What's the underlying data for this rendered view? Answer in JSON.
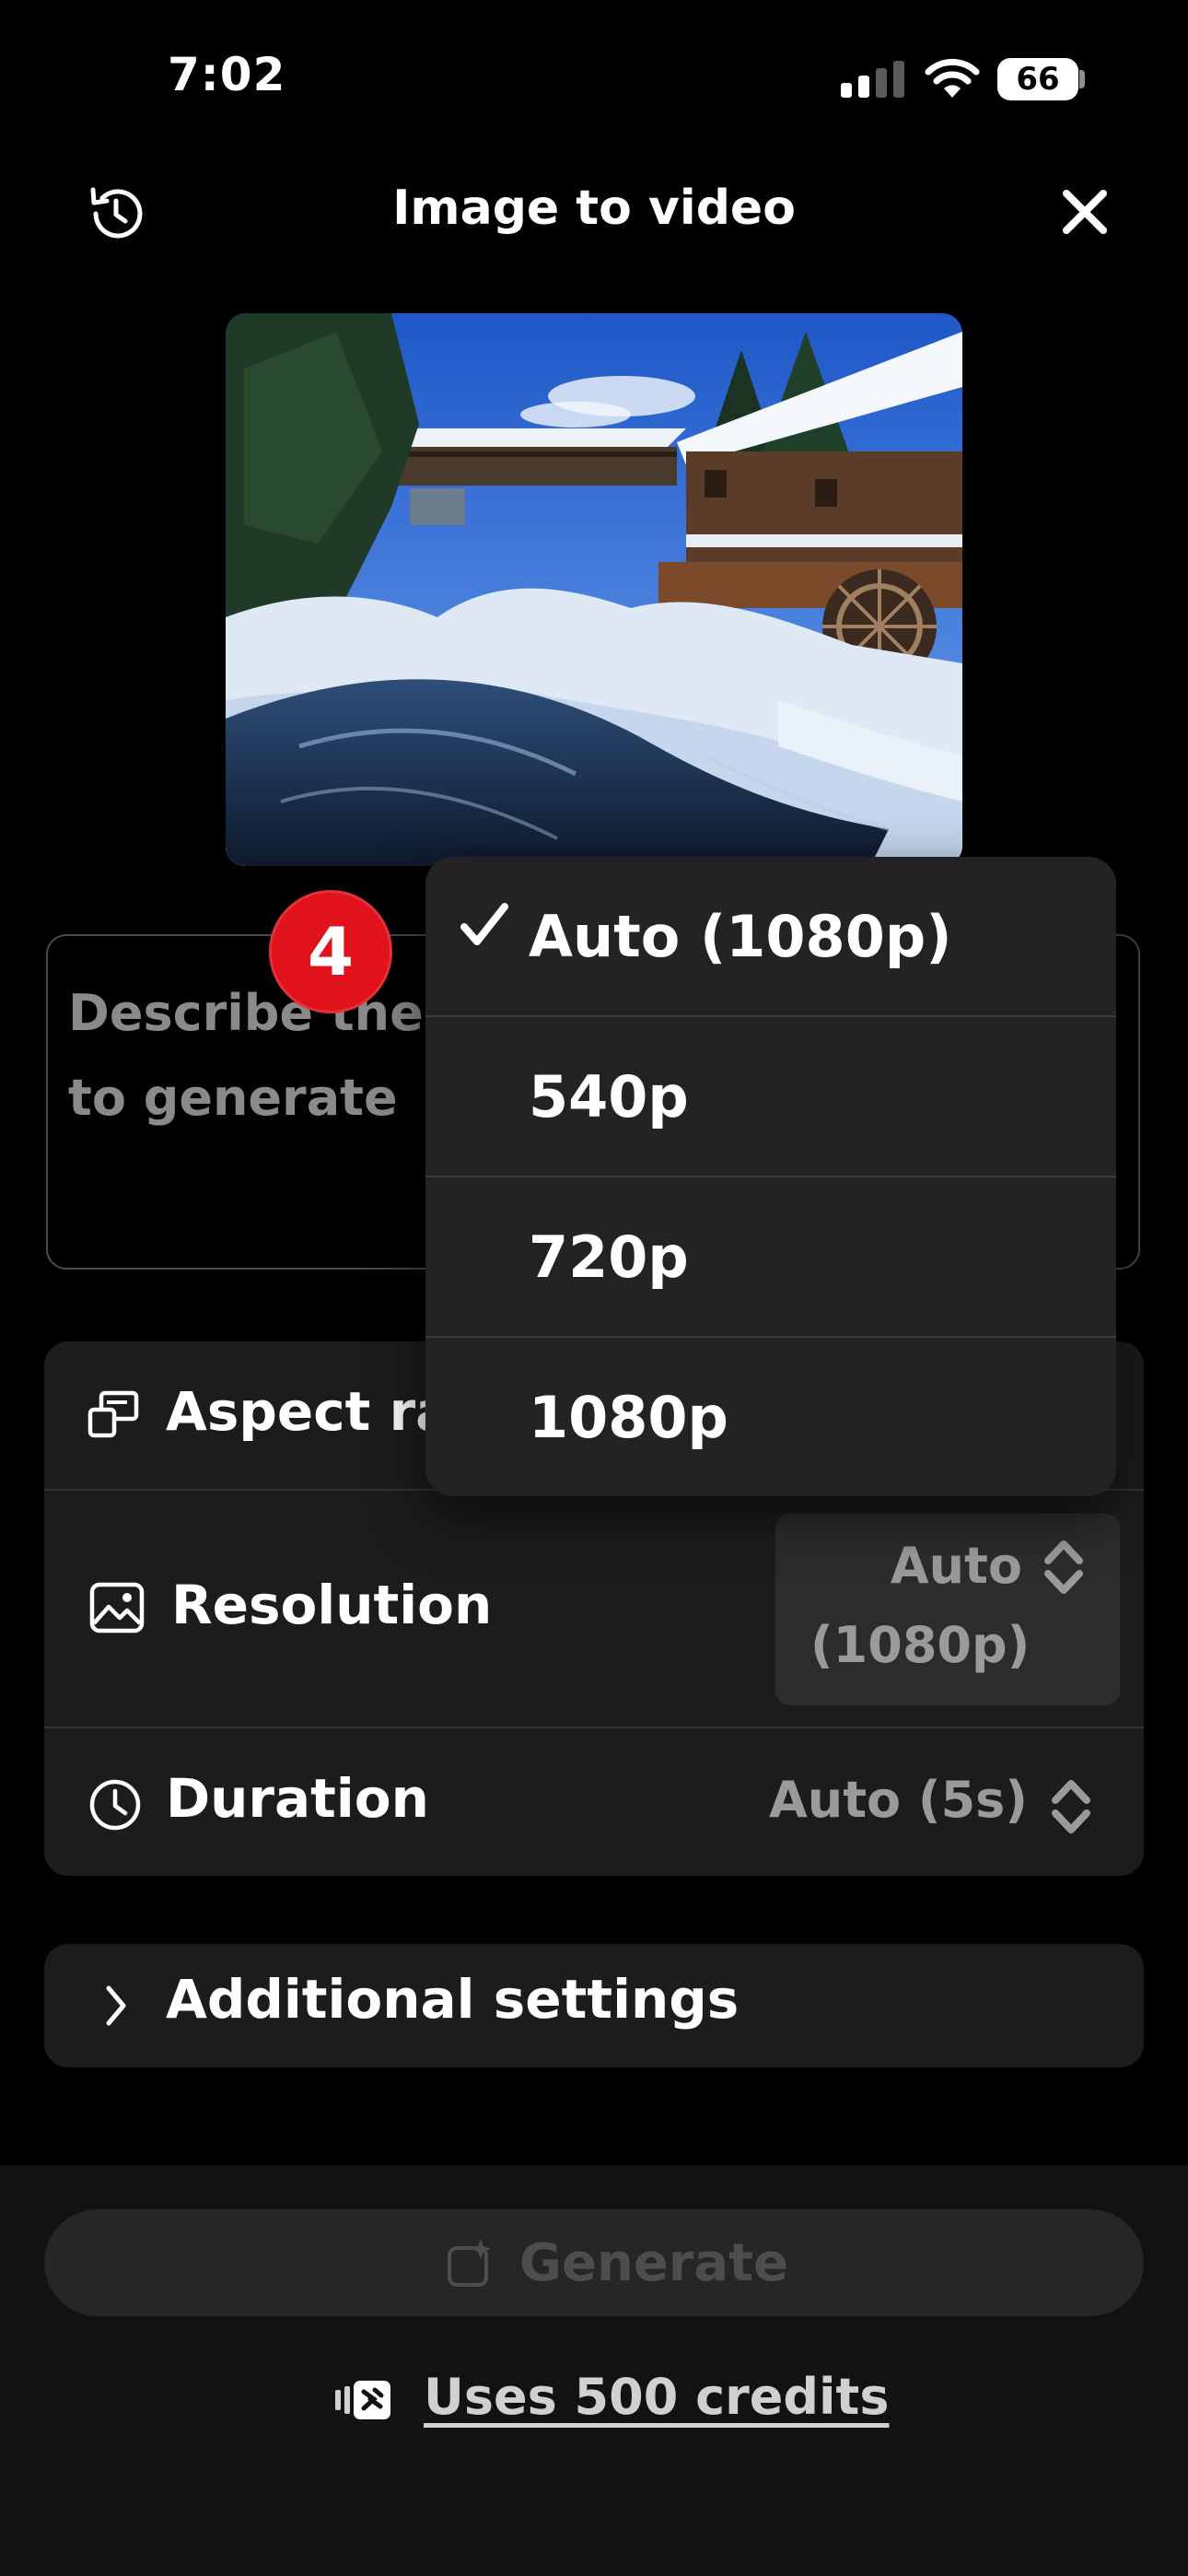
{
  "status_bar": {
    "time": "7:02",
    "battery": "66"
  },
  "header": {
    "title": "Image to video"
  },
  "prompt": {
    "placeholder": "Describe the video you want to generate",
    "visible_text": "Describe the\nto generate"
  },
  "settings": {
    "aspect_ratio": {
      "label": "Aspect ra"
    },
    "resolution": {
      "label": "Resolution",
      "value_line1": "Auto",
      "value_line2": "(1080p)"
    },
    "duration": {
      "label": "Duration",
      "value": "Auto (5s)"
    }
  },
  "additional_settings": {
    "label": "Additional settings"
  },
  "footer": {
    "generate_label": "Generate",
    "credits_label": "Uses 500 credits"
  },
  "dropdown": {
    "options": [
      {
        "label": "Auto (1080p)",
        "selected": true
      },
      {
        "label": "540p",
        "selected": false
      },
      {
        "label": "720p",
        "selected": false
      },
      {
        "label": "1080p",
        "selected": false
      }
    ]
  },
  "annotation": {
    "step": "4",
    "color": "#e0121b"
  },
  "colors": {
    "background": "#000000",
    "card": "#1c1c1c",
    "dropdown": "#232323",
    "muted_text": "#9a9a9a"
  }
}
